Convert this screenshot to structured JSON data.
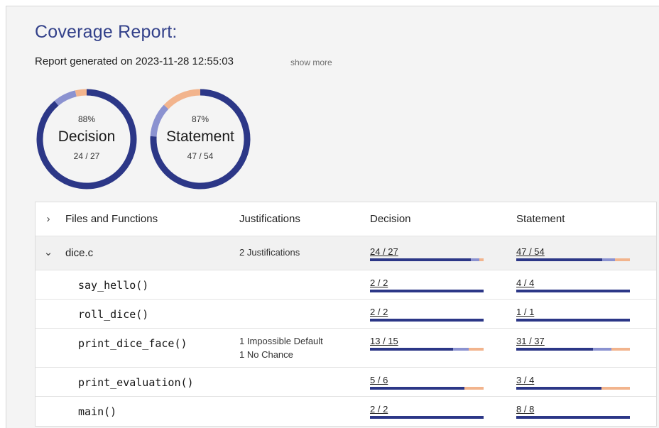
{
  "report": {
    "title": "Coverage Report:",
    "generated": "Report generated on 2023-11-28 12:55:03",
    "show_more": "show more"
  },
  "colors": {
    "covered": "#2c3787",
    "justified": "#8b92d0",
    "uncovered": "#f2b48d",
    "title": "#33418a"
  },
  "gauges": [
    {
      "percent": "88%",
      "label": "Decision",
      "fraction": "24 / 27",
      "covered": 24,
      "justified": 2,
      "total": 27
    },
    {
      "percent": "87%",
      "label": "Statement",
      "fraction": "47 / 54",
      "covered": 41,
      "justified": 6,
      "total": 54
    }
  ],
  "table": {
    "headers": {
      "files": "Files and Functions",
      "justifications": "Justifications",
      "decision": "Decision",
      "statement": "Statement"
    },
    "header_chevron": "›",
    "file": {
      "chevron": "⌄",
      "name": "dice.c",
      "justifications": "2 Justifications",
      "decision": "24 / 27",
      "dec_cov": 24,
      "dec_jus": 2,
      "dec_total": 27,
      "statement": "47 / 54",
      "st_cov": 41,
      "st_jus": 6,
      "st_total": 54
    },
    "functions": [
      {
        "name": "say_hello()",
        "just1": "",
        "just2": "",
        "decision": "2 / 2",
        "dec_cov": 2,
        "dec_jus": 0,
        "dec_total": 2,
        "statement": "4 / 4",
        "st_cov": 4,
        "st_jus": 0,
        "st_total": 4
      },
      {
        "name": "roll_dice()",
        "just1": "",
        "just2": "",
        "decision": "2 / 2",
        "dec_cov": 2,
        "dec_jus": 0,
        "dec_total": 2,
        "statement": "1 / 1",
        "st_cov": 1,
        "st_jus": 0,
        "st_total": 1
      },
      {
        "name": "print_dice_face()",
        "just1": "1 Impossible Default",
        "just2": "1 No Chance",
        "decision": "13 / 15",
        "dec_cov": 11,
        "dec_jus": 2,
        "dec_total": 15,
        "statement": "31 / 37",
        "st_cov": 25,
        "st_jus": 6,
        "st_total": 37
      },
      {
        "name": "print_evaluation()",
        "just1": "",
        "just2": "",
        "decision": "5 / 6",
        "dec_cov": 5,
        "dec_jus": 0,
        "dec_total": 6,
        "statement": "3 / 4",
        "st_cov": 3,
        "st_jus": 0,
        "st_total": 4
      },
      {
        "name": "main()",
        "just1": "",
        "just2": "",
        "decision": "2 / 2",
        "dec_cov": 2,
        "dec_jus": 0,
        "dec_total": 2,
        "statement": "8 / 8",
        "st_cov": 8,
        "st_jus": 0,
        "st_total": 8
      }
    ]
  }
}
